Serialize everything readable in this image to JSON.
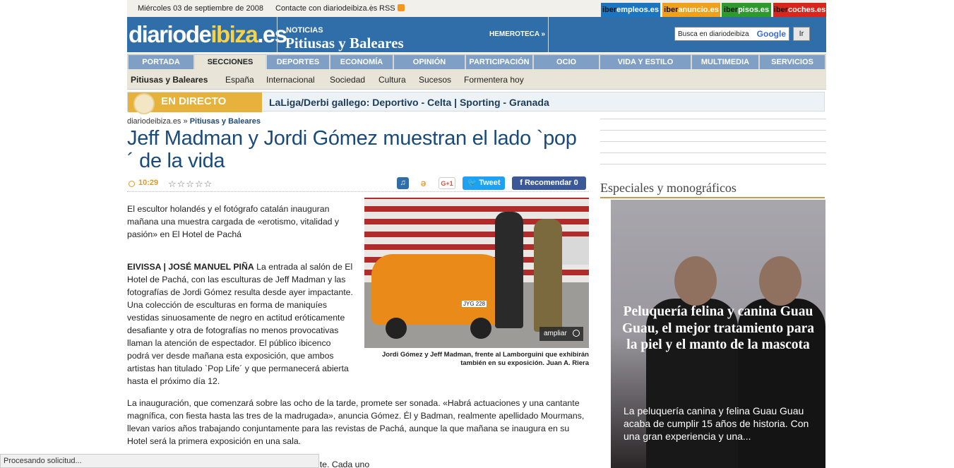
{
  "topbar": {
    "date": "Miércoles 03 de septiembre de 2008",
    "contact": "Contacte con diariodeibiza.es",
    "separator": "|",
    "rss": "RSS"
  },
  "partners": [
    {
      "a": "iber",
      "b": "empleos.es"
    },
    {
      "a": "iber",
      "b": "anuncio.es"
    },
    {
      "a": "iber",
      "b": "pisos.es"
    },
    {
      "a": "iber",
      "b": "coches.es"
    }
  ],
  "header": {
    "logo_a": "diariode",
    "logo_b": "ibiza",
    "logo_c": ".es",
    "news_label": "NOTICIAS",
    "news_title": "Pitiusas y Baleares",
    "hemeroteca": "HEMEROTECA »",
    "search_placeholder": "Busca en diariodeibiza",
    "search_brand": "Google",
    "search_button": "Ir"
  },
  "nav": [
    "PORTADA",
    "SECCIONES",
    "DEPORTES",
    "ECONOMÍA",
    "OPINIÓN",
    "PARTICIPACIÓN",
    "OCIO",
    "VIDA Y ESTILO",
    "MULTIMEDIA",
    "SERVICIOS"
  ],
  "subnav": [
    "Pitiusas y Baleares",
    "España",
    "Internacional",
    "Sociedad",
    "Cultura",
    "Sucesos",
    "Formentera hoy"
  ],
  "live": {
    "badge": "EN DIRECTO",
    "text": "LaLiga/Derbi gallego: Deportivo - Celta  | Sporting - Granada"
  },
  "article": {
    "crumb_site": "diariodeibiza.es",
    "crumb_sep": "»",
    "crumb_section": "Pitiusas y Baleares",
    "headline": "Jeff Madman y Jordi Gómez muestran el lado `pop´ de la vida",
    "time": "10:29",
    "stars": "☆☆☆☆☆",
    "tweet": "Tweet",
    "recommend": "Recomendar 0",
    "gplus": "G+1",
    "lead": "El escultor holandés y el fotógrafo catalán inauguran mañana una muestra cargada de «erotismo, vitalidad y pasión» en El Hotel de Pachá",
    "byline": "EIVISSA | JOSÉ MANUEL PIÑA",
    "body1": "La entrada al salón de El Hotel de Pachá, con las esculturas de Jeff Madman y las fotografías de Jordi Gómez resulta desde ayer impactante. Una colección de esculturas en forma de maniquíes vestidas sinuosamente de negro en actitud eróticamente desafiante y otra de fotografías no menos provocativas llaman la atención de espectador. El público ibicenco podrá ver desde mañana esta exposición, que ambos artistas han titulado `Pop Life´ y que permanecerá abierta hasta el próximo día 12.",
    "body2": "La inauguración, que comenzará sobre las ocho de la tarde, promete ser sonada. «Habrá actuaciones y una cantante magnífica, con fiesta hasta las tres de la madrugada», anuncia Gómez. Él y Badman, realmente apellidado Mourmans, llevan varios años trabajando conjuntamente para las revistas de Pachá, aunque la que mañana se inaugura en su Hotel será la primera exposición en una sala.",
    "body3": "racterizan por su fuerza vital, no te dejan indiferente. Cada uno",
    "zoom": "ampliar",
    "caption": "Jordi Gómez y Jeff Madman, frente al Lamborguini que exhibirán también en su exposición.  Juan A. Riera",
    "plate": "JYG 228"
  },
  "sidebar": {
    "title": "Especiales y monográficos",
    "promo_title": "Peluquería felina y canina Guau Guau, el mejor tratamiento para la piel y el manto de la mascota",
    "promo_text": "La peluquería canina y felina Guau Guau acaba de cumplir 15 años de historia. Con una gran experiencia y una..."
  },
  "status": "Procesando solicitud..."
}
